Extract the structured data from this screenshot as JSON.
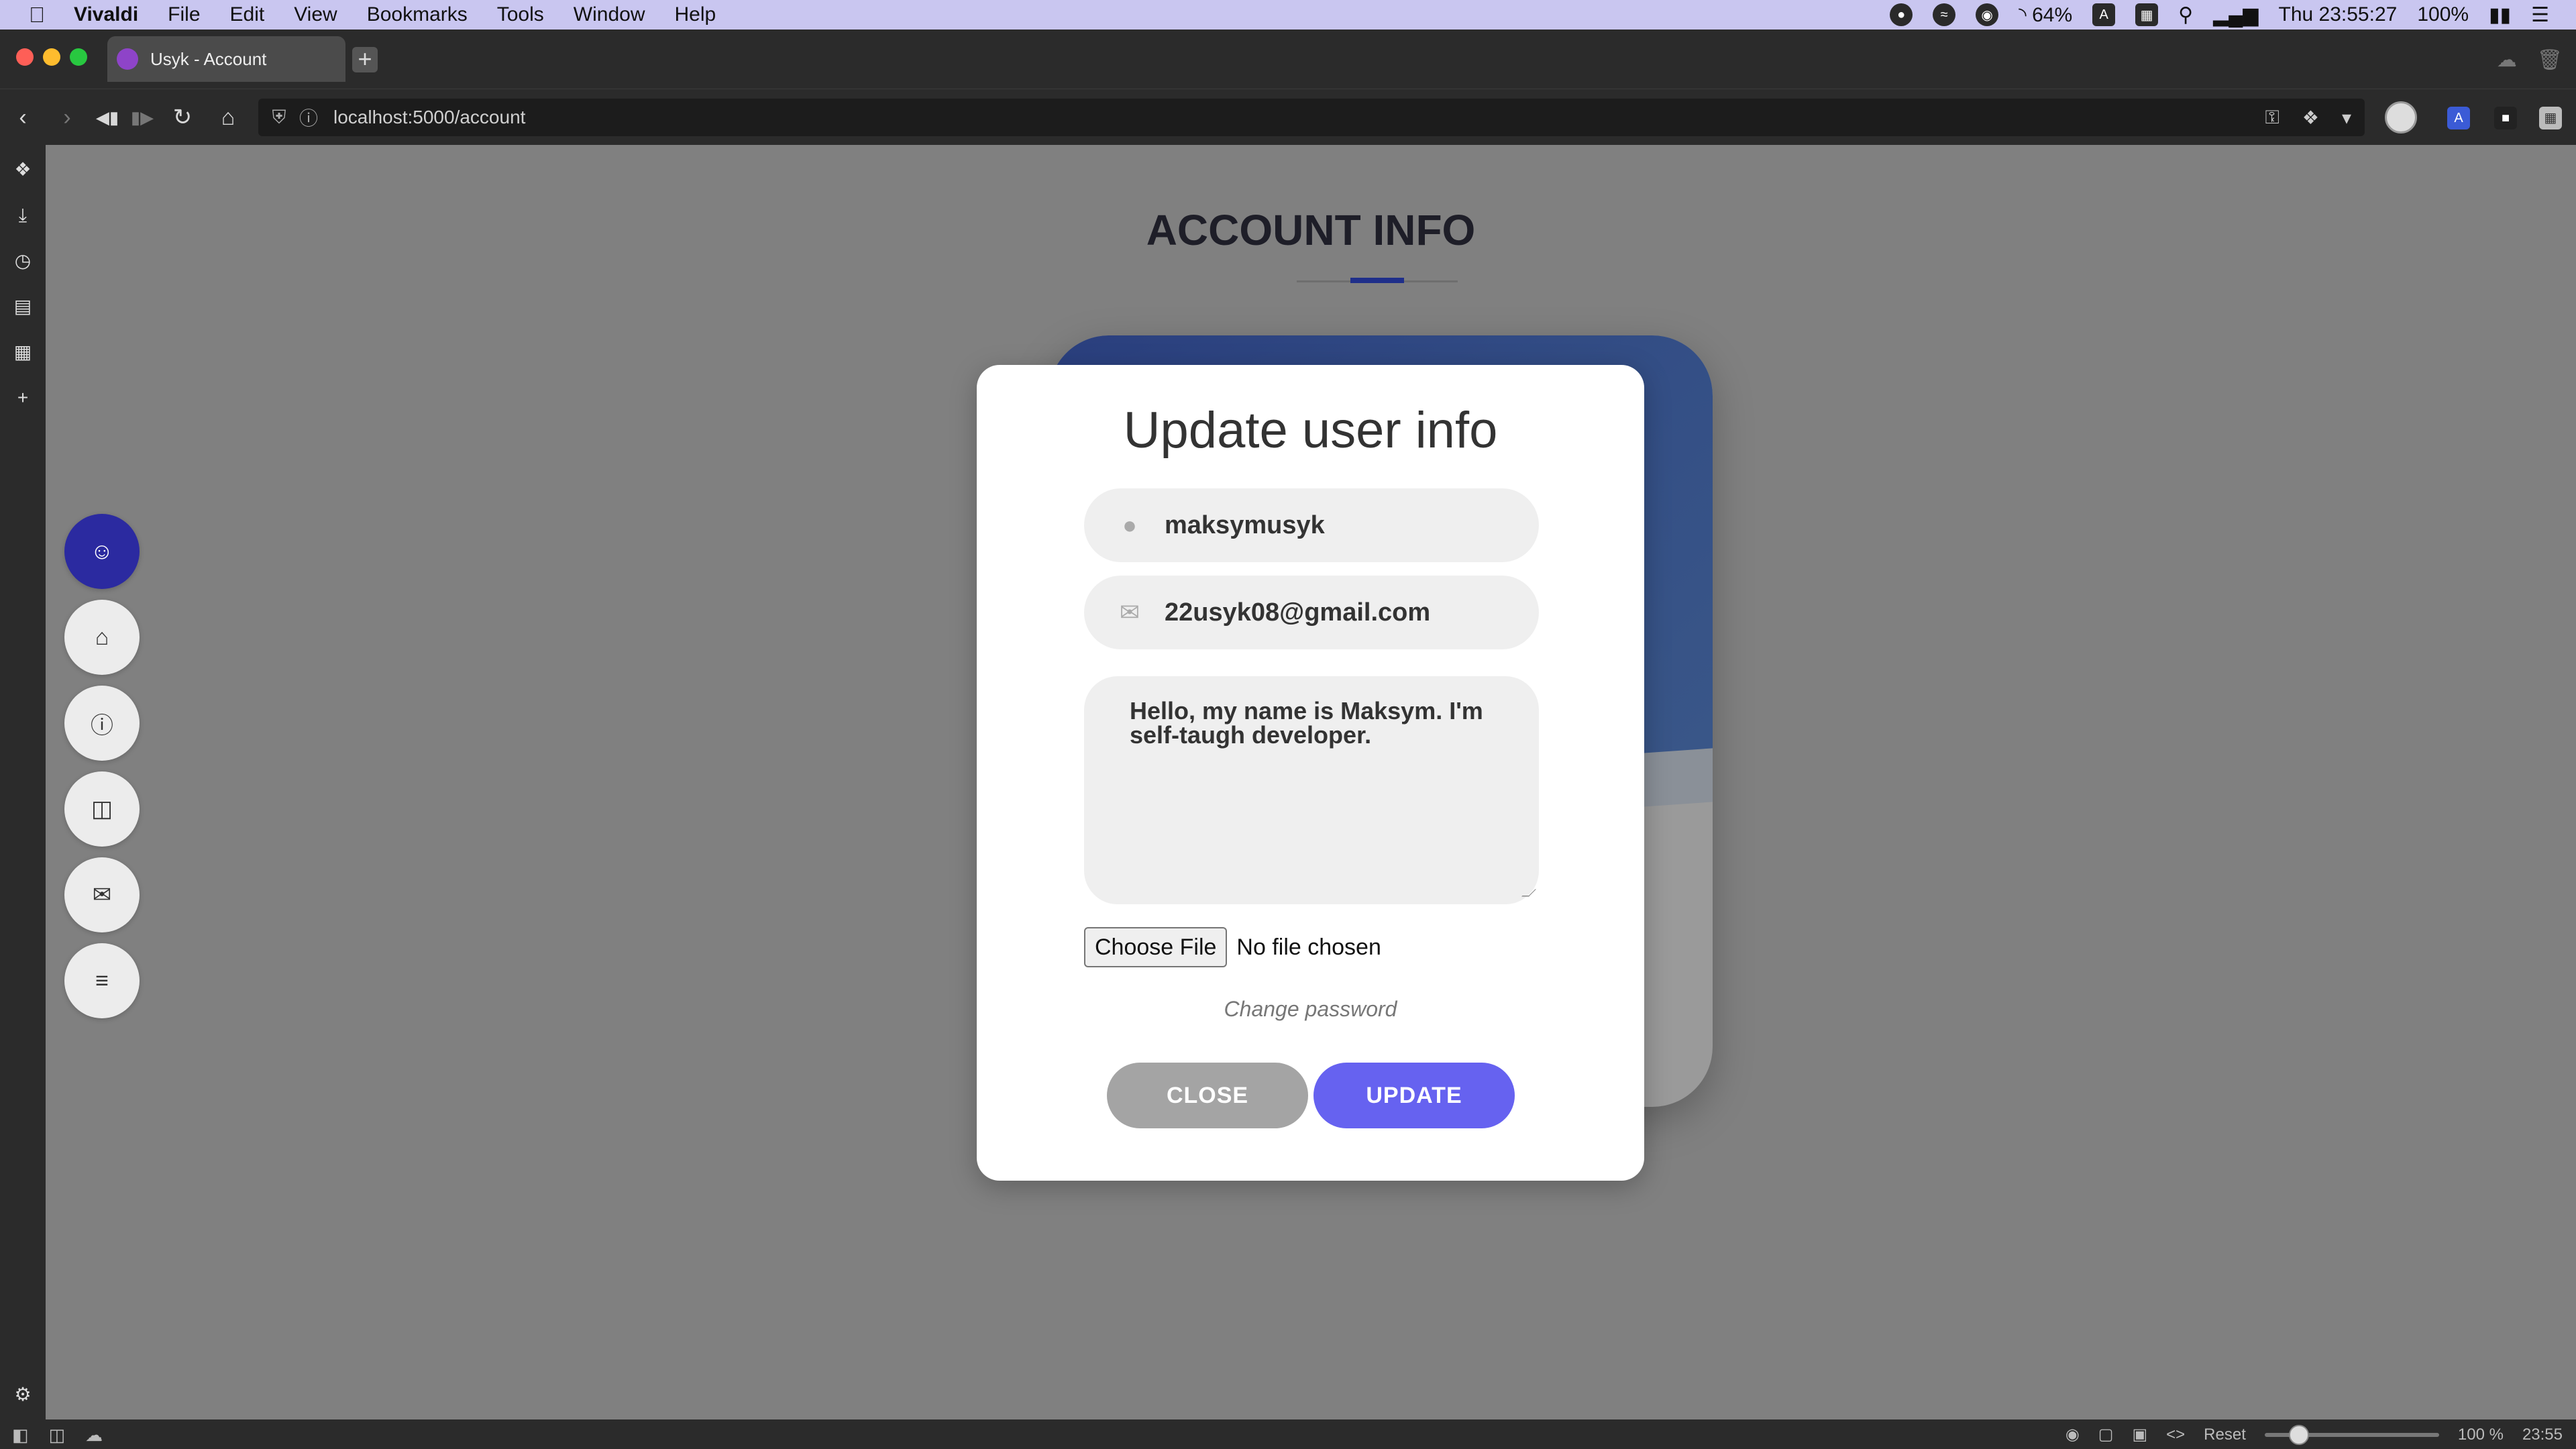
{
  "menubar": {
    "app": "Vivaldi",
    "items": [
      "File",
      "Edit",
      "View",
      "Bookmarks",
      "Tools",
      "Window",
      "Help"
    ],
    "battery_small": "64%",
    "clock": "Thu 23:55:27",
    "battery": "100%"
  },
  "browser": {
    "tab_title": "Usyk - Account",
    "url": "localhost:5000/account"
  },
  "page": {
    "title": "ACCOUNT INFO"
  },
  "sidebar": {
    "items": [
      {
        "icon": "user-icon",
        "active": true
      },
      {
        "icon": "home-icon",
        "active": false
      },
      {
        "icon": "info-icon",
        "active": false
      },
      {
        "icon": "book-icon",
        "active": false
      },
      {
        "icon": "mail-icon",
        "active": false
      },
      {
        "icon": "list-check-icon",
        "active": false
      }
    ]
  },
  "modal": {
    "title": "Update user info",
    "username": "maksymusyk",
    "email": "22usyk08@gmail.com",
    "bio": "Hello, my name is Maksym. I'm self-taugh developer.",
    "file_button": "Choose File",
    "file_status": "No file chosen",
    "change_password": "Change password",
    "close_label": "CLOSE",
    "update_label": "UPDATE"
  },
  "statusbar": {
    "reset": "Reset",
    "zoom": "100 %",
    "time": "23:55"
  },
  "colors": {
    "accent": "#6662f0",
    "active_nav": "#2b2aa0",
    "card_header": "#2a3f7e"
  }
}
